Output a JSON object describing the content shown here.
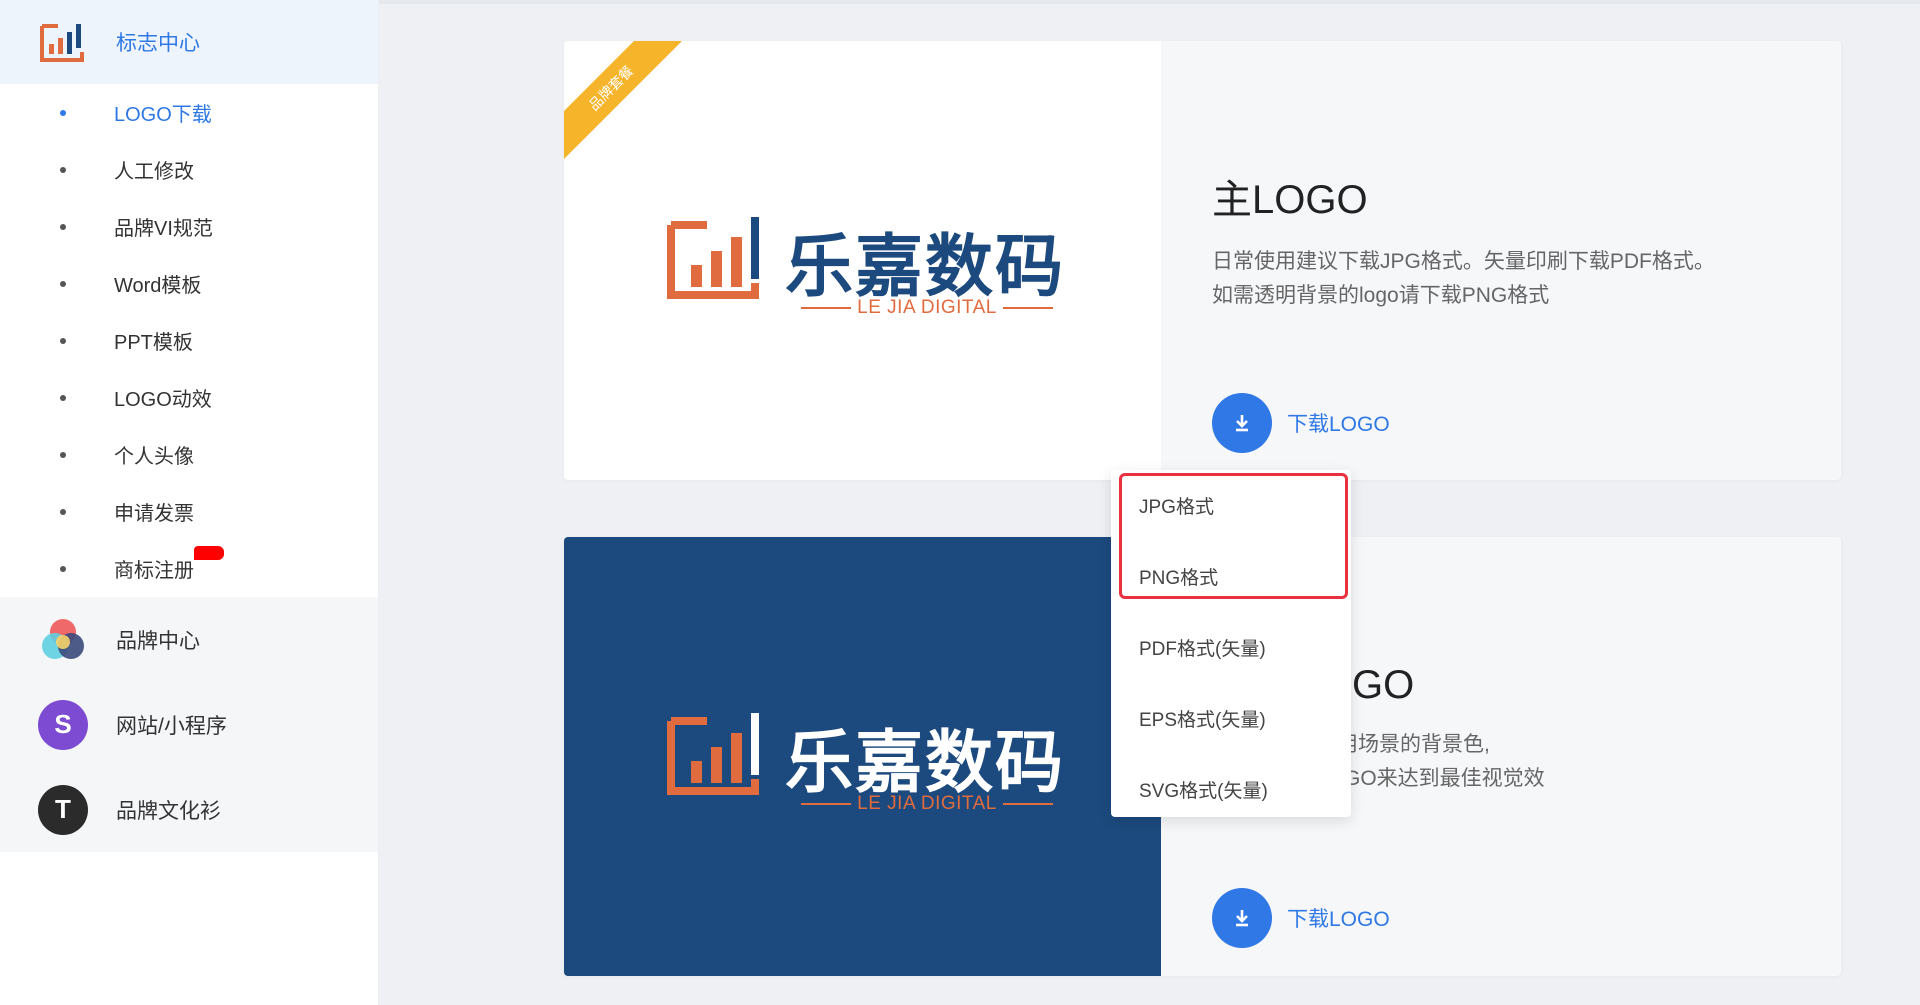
{
  "sidebar": {
    "header_title": "标志中心",
    "sub_items": [
      {
        "label": "LOGO下载",
        "active": true
      },
      {
        "label": "人工修改"
      },
      {
        "label": "品牌VI规范"
      },
      {
        "label": "Word模板"
      },
      {
        "label": "PPT模板"
      },
      {
        "label": "LOGO动效"
      },
      {
        "label": "个人头像"
      },
      {
        "label": "申请发票"
      },
      {
        "label": "商标注册",
        "badge": true
      }
    ],
    "groups": [
      {
        "label": "品牌中心",
        "icon": "color-circles-icon"
      },
      {
        "label": "网站/小程序",
        "icon": "s-circle-icon",
        "glyph": "S"
      },
      {
        "label": "品牌文化衫",
        "icon": "t-circle-icon",
        "glyph": "T"
      }
    ]
  },
  "cards": [
    {
      "ribbon": "品牌套餐",
      "logo_text": "乐嘉数码",
      "logo_sub": "LE JIA DIGITAL",
      "title": "主LOGO",
      "desc_line1": "日常使用建议下载JPG格式。矢量印刷下载PDF格式。",
      "desc_line2": "如需透明背景的logo请下载PNG格式",
      "download_label": "下载LOGO"
    },
    {
      "logo_text": "乐嘉数码",
      "logo_sub": "LE JIA DIGITAL",
      "title_partial": "GO",
      "desc_line1_partial": "使用场景的背景色,",
      "desc_line2_partial": "LOGO来达到最佳视觉效",
      "download_label": "下载LOGO"
    }
  ],
  "dropdown": {
    "options": [
      "JPG格式",
      "PNG格式",
      "PDF格式(矢量)",
      "EPS格式(矢量)",
      "SVG格式(矢量)"
    ]
  },
  "colors": {
    "accent": "#2f78e6",
    "brand_navy": "#1c4a7e",
    "brand_orange": "#e06b3f",
    "highlight_red": "#e8323f",
    "ribbon": "#f5b42a"
  }
}
